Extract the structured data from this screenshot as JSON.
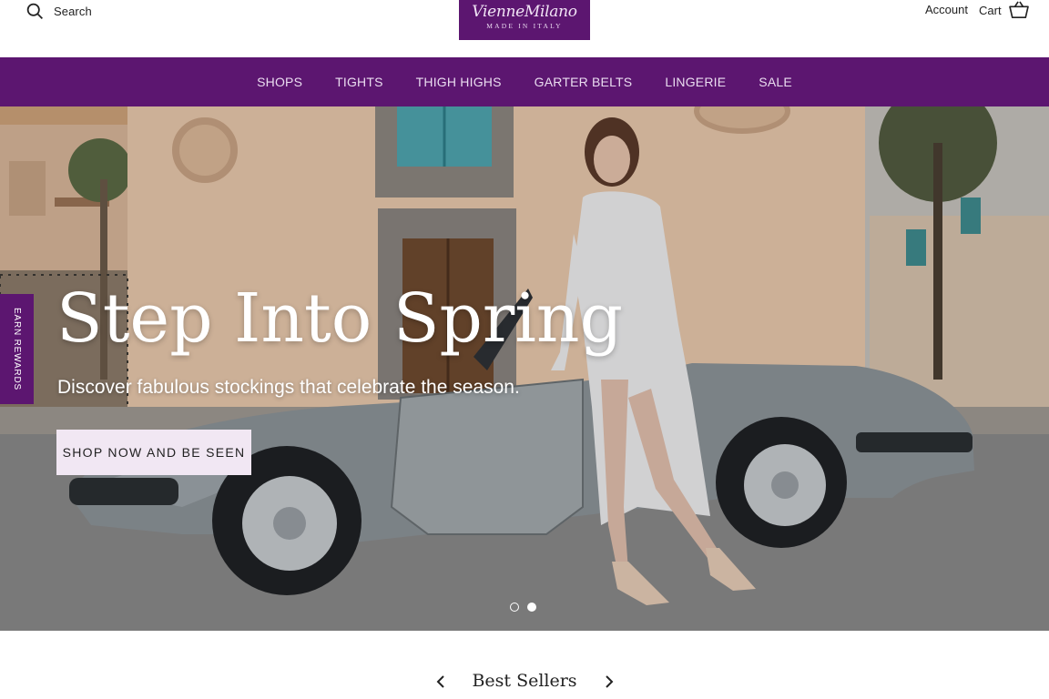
{
  "header": {
    "search_label": "Search",
    "logo_brand": "VienneMilano",
    "logo_tagline": "MADE IN ITALY",
    "account_label": "Account",
    "cart_label": "Cart"
  },
  "nav": {
    "items": [
      "SHOPS",
      "TIGHTS",
      "THIGH HIGHS",
      "GARTER BELTS",
      "LINGERIE",
      "SALE"
    ]
  },
  "hero": {
    "title": "Step Into Spring",
    "subtitle": "Discover fabulous stockings that celebrate the season.",
    "cta_label": "SHOP NOW AND BE SEEN",
    "slides_total": 2,
    "active_slide": 2
  },
  "rewards": {
    "label": "EARN REWARDS"
  },
  "best_sellers": {
    "title": "Best Sellers"
  },
  "colors": {
    "brand_purple": "#5c1670",
    "nav_text": "#eadcf0",
    "cta_background": "#f1e7f3"
  },
  "icons": [
    "search-icon",
    "cart-icon",
    "chevron-left-icon",
    "chevron-right-icon"
  ]
}
